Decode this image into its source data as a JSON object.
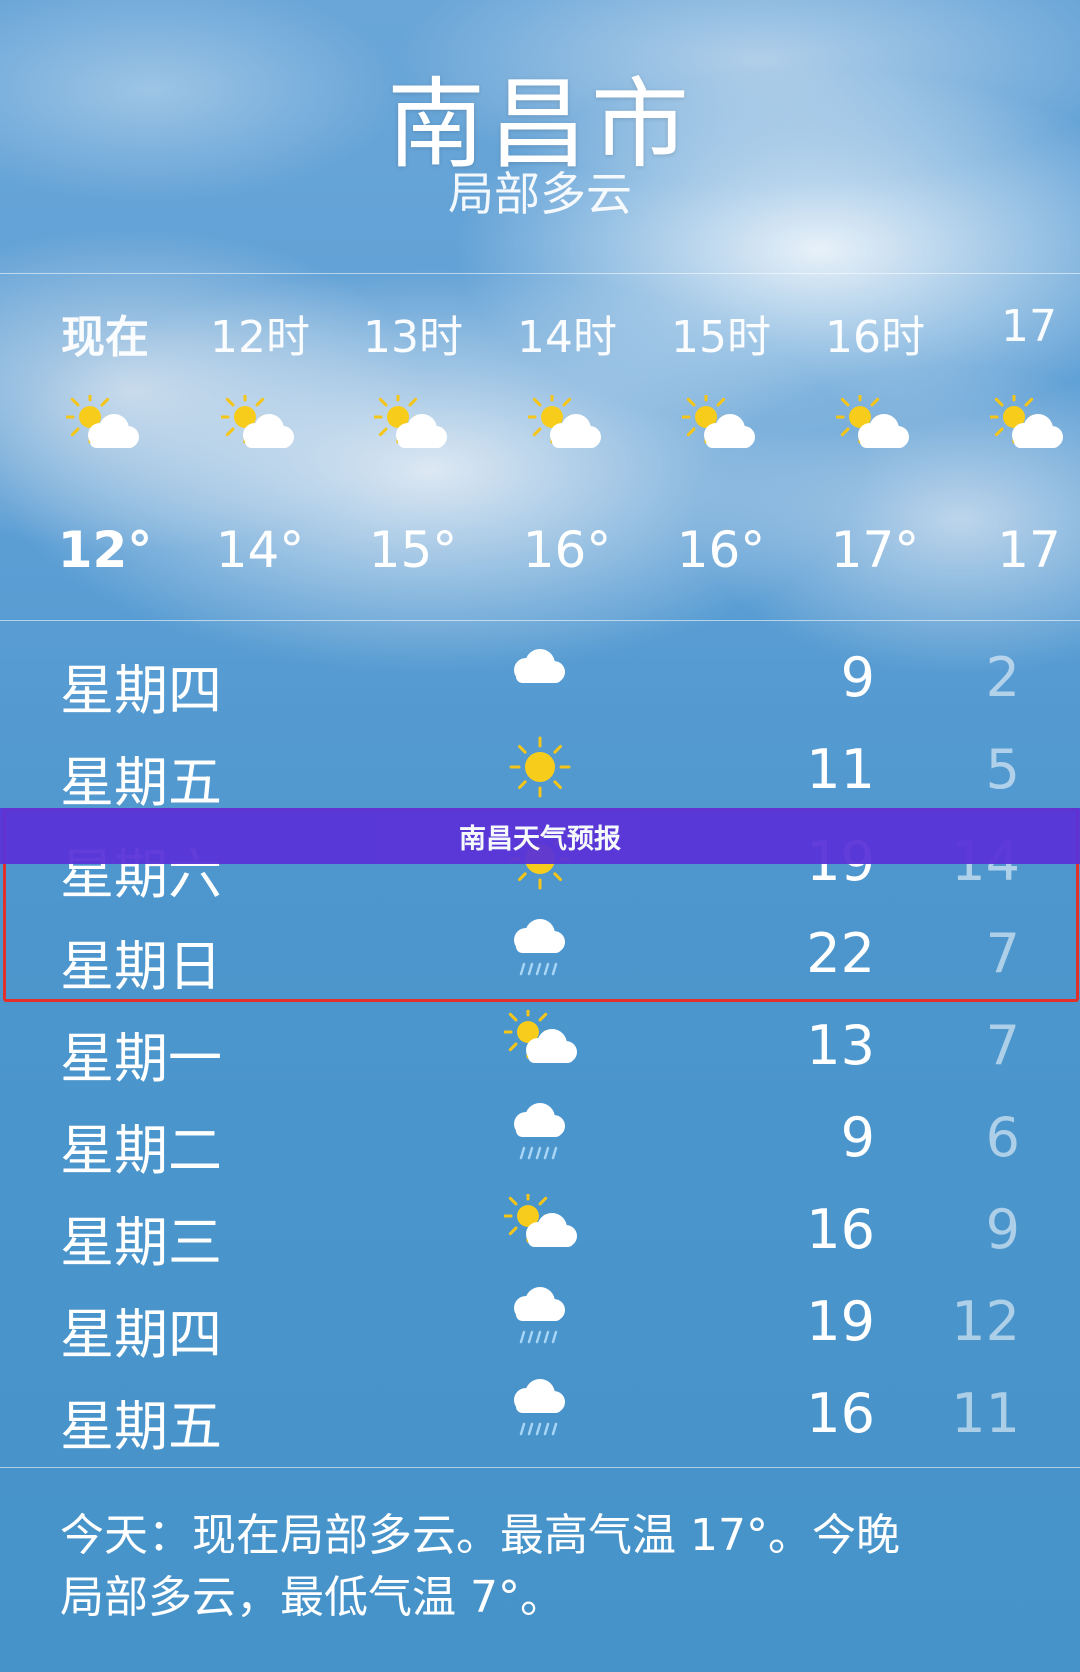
{
  "header": {
    "city": "南昌市",
    "condition": "局部多云"
  },
  "hourly": [
    {
      "label": "现在",
      "icon": "partly-cloudy-icon",
      "temp": "12°"
    },
    {
      "label": "12时",
      "icon": "partly-cloudy-icon",
      "temp": "14°"
    },
    {
      "label": "13时",
      "icon": "partly-cloudy-icon",
      "temp": "15°"
    },
    {
      "label": "14时",
      "icon": "partly-cloudy-icon",
      "temp": "16°"
    },
    {
      "label": "15时",
      "icon": "partly-cloudy-icon",
      "temp": "16°"
    },
    {
      "label": "16时",
      "icon": "partly-cloudy-icon",
      "temp": "17°"
    },
    {
      "label": "17",
      "icon": "partly-cloudy-icon",
      "temp": "17"
    }
  ],
  "daily": [
    {
      "day": "星期四",
      "icon": "cloud-icon",
      "high": "9",
      "low": "2"
    },
    {
      "day": "星期五",
      "icon": "sun-icon",
      "high": "11",
      "low": "5"
    },
    {
      "day": "星期六",
      "icon": "sun-icon",
      "high": "19",
      "low": "14"
    },
    {
      "day": "星期日",
      "icon": "rain-icon",
      "high": "22",
      "low": "7"
    },
    {
      "day": "星期一",
      "icon": "partly-cloudy-icon",
      "high": "13",
      "low": "7"
    },
    {
      "day": "星期二",
      "icon": "rain-icon",
      "high": "9",
      "low": "6"
    },
    {
      "day": "星期三",
      "icon": "partly-cloudy-icon",
      "high": "16",
      "low": "9"
    },
    {
      "day": "星期四",
      "icon": "rain-icon",
      "high": "19",
      "low": "12"
    },
    {
      "day": "星期五",
      "icon": "rain-icon",
      "high": "16",
      "low": "11"
    }
  ],
  "summary": {
    "line1": "今天：现在局部多云。最高气温 17°。今晚",
    "line2": "局部多云，最低气温 7°。"
  },
  "banner": {
    "text": "南昌天气预报"
  },
  "colors": {
    "banner": "#5a33d8",
    "highlight_border": "#e2302a",
    "sky": "#4a98cf"
  }
}
